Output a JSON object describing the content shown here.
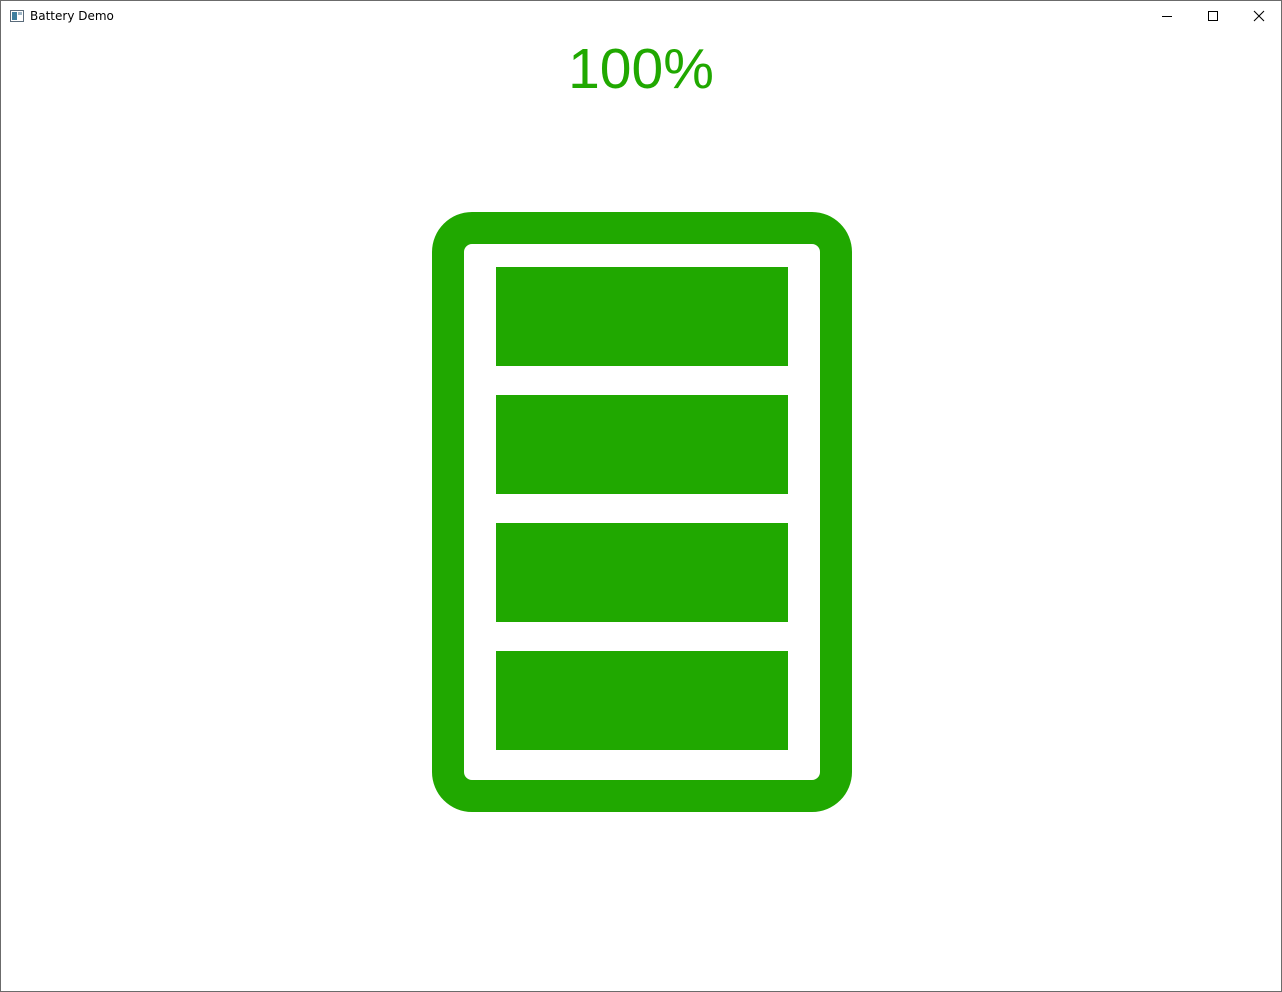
{
  "window": {
    "title": "Battery Demo"
  },
  "titlebar": {
    "minimize_icon": "minimize-icon",
    "maximize_icon": "maximize-icon",
    "close_icon": "close-icon"
  },
  "battery": {
    "percent_label": "100%",
    "level": 1.0,
    "segments_total": 4,
    "segments_filled": 4,
    "color": "#20a800"
  }
}
